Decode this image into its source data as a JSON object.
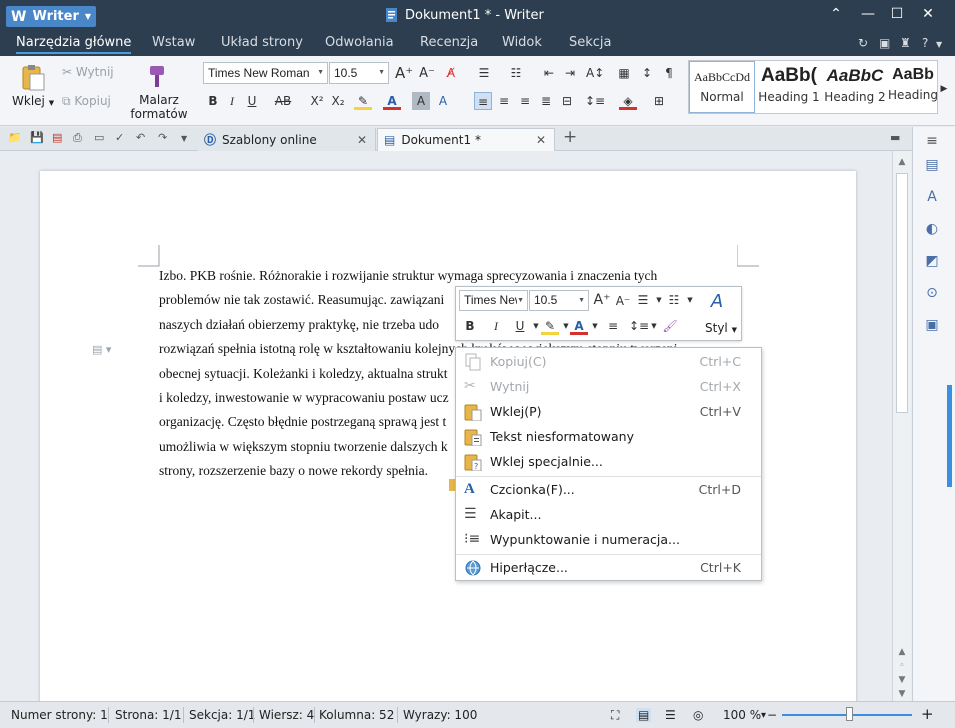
{
  "window": {
    "app_button": "Writer",
    "title": "Dokument1 * - Writer"
  },
  "menu": {
    "tabs": [
      "Narzędzia główne",
      "Wstaw",
      "Układ strony",
      "Odwołania",
      "Recenzja",
      "Widok",
      "Sekcja"
    ],
    "help": "?"
  },
  "ribbon": {
    "paste": "Wklej",
    "cut": "Wytnij",
    "copy": "Kopiuj",
    "format_painter_line1": "Malarz",
    "format_painter_line2": "formatów",
    "font_name": "Times New Roman",
    "font_size": "10.5",
    "styles": [
      {
        "sample": "AaBbCcDd",
        "label": "Normal"
      },
      {
        "sample": "AaBb(",
        "label": "Heading 1"
      },
      {
        "sample": "AaBbC",
        "label": "Heading 2"
      },
      {
        "sample": "AaBb",
        "label": "Heading"
      }
    ]
  },
  "tabs": {
    "online_templates": "Szablony online",
    "document": "Dokument1 *"
  },
  "document": {
    "lines": [
      "Izbo. PKB rośnie. Różnorakie i rozwijanie struktur wymaga sprecyzowania i znaczenia tych",
      "problemów nie tak zostawić. Reasumując. zawiązani",
      "naszych działań  obierzemy praktykę, nie trzeba udo",
      "rozwiązań  spełnia istotną rolę w kształtowaniu kolejnych kroków w większym stopniu tworzenie",
      "obecnej sytuacji. Koleżanki i koledzy, aktualna strukt",
      "i koledzy, inwestowanie w wypracowaniu postaw ucz",
      "organizację. Często błędnie postrzeganą sprawą jest t",
      "umożliwia w większym stopniu tworzenie dalszych k",
      "strony, rozszerzenie bazy o nowe rekordy spełnia."
    ]
  },
  "mini_toolbar": {
    "font_name": "Times New Roman",
    "font_size": "10.5",
    "style_label": "Styl"
  },
  "context_menu": {
    "items": [
      {
        "label": "Kopiuj(C)",
        "shortcut": "Ctrl+C",
        "disabled": true
      },
      {
        "label": "Wytnij",
        "shortcut": "Ctrl+X",
        "disabled": true
      },
      {
        "label": "Wklej(P)",
        "shortcut": "Ctrl+V",
        "disabled": false
      },
      {
        "label": "Tekst niesformatowany",
        "shortcut": "",
        "disabled": false
      },
      {
        "label": "Wklej specjalnie...",
        "shortcut": "",
        "disabled": false
      },
      {
        "label": "Czcionka(F)...",
        "shortcut": "Ctrl+D",
        "disabled": false
      },
      {
        "label": "Akapit...",
        "shortcut": "",
        "disabled": false
      },
      {
        "label": "Wypunktowanie i numeracja...",
        "shortcut": "",
        "disabled": false
      },
      {
        "label": "Hiperłącze...",
        "shortcut": "Ctrl+K",
        "disabled": false
      }
    ]
  },
  "status": {
    "page_number": "Numer strony: 1",
    "page": "Strona: 1/1",
    "section": "Sekcja: 1/1",
    "line": "Wiersz: 4",
    "column": "Kolumna: 52",
    "words": "Wyrazy: 100",
    "zoom": "100 %",
    "zoom_minus": "−",
    "zoom_plus": "+"
  },
  "colors": {
    "titlebar": "#2d3e50",
    "accent": "#4a87c8",
    "highlight": "#f5d33a",
    "font_color": "#d6322c"
  }
}
